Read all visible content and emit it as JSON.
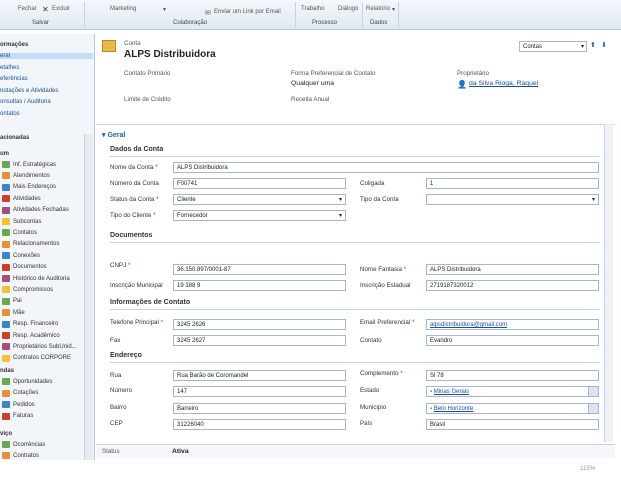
{
  "ribbon": {
    "fechar": "Fechar",
    "excluir": "Excluir",
    "marketing": "Marketing",
    "enviar": "Enviar um Link por Email",
    "trabalho": "Trabalho",
    "dialogo": "Diálogo",
    "relatorio": "Relatório",
    "g_salvar": "Salvar",
    "g_colab": "Colaboração",
    "g_processo": "Processo",
    "g_dados": "Dados"
  },
  "nav": {
    "sec_info": "ormações",
    "info": [
      "eral",
      "etalhes",
      "eferências",
      "notações e Atividades",
      "onsultas / Auditoria",
      "ontatos"
    ],
    "sec_rel": "acionadas",
    "sec_common": "um",
    "common": [
      "Inf. Estratégicas",
      "Atendimentos",
      "Mais Endereços",
      "Atividades",
      "Atividades Fechadas",
      "Subcontas",
      "Contatos",
      "Relacionamentos",
      "Conexões",
      "Documentos",
      "Histórico de Auditoria",
      "Compromissos",
      "Pai",
      "Mãe",
      "Resp. Financeiro",
      "Resp. Acadêmico",
      "Proprietários SubUnid...",
      "Contratos CORPORE"
    ],
    "sec_vendas": "ndas",
    "vendas": [
      "Oportunidades",
      "Cotações",
      "Pedidos",
      "Faturas"
    ],
    "sec_servico": "viço",
    "servico": [
      "Ocorrências",
      "Contratos"
    ]
  },
  "header": {
    "entity": "Conta",
    "name": "ALPS Distribuidora",
    "form_selector": "Contas",
    "contato_primario_label": "Contato Primário",
    "forma_label": "Forma Preferencial de Contato",
    "forma_value": "Qualquer uma",
    "proprietario_label": "Proprietário",
    "proprietario_value": "da Silva Rioga, Raquel",
    "limite_label": "Limite de Crédito",
    "receita_label": "Receita Anual"
  },
  "form": {
    "tab": "Geral",
    "s_dados": "Dados da Conta",
    "nome_label": "Nome da Conta",
    "nome": "ALPS Distribuidora",
    "numero_label": "Número da Conta",
    "numero": "F00741",
    "coligada_label": "Coligada",
    "coligada": "1",
    "status_label": "Status da Conta",
    "status": "Cliente",
    "tipoconta_label": "Tipo da Conta",
    "tipoconta": "",
    "tipocliente_label": "Tipo do Cliente",
    "tipocliente": "Fornecedor",
    "s_docs": "Documentos",
    "cnpj_label": "CNPJ",
    "cnpj": "36.150.897/0001-87",
    "fantasia_label": "Nome Fantasia",
    "fantasia": "ALPS Distribuidora",
    "im_label": "Inscrição Municipal",
    "im": "19 188 9",
    "ie_label": "Inscrição Estadual",
    "ie": "2719187320012",
    "s_contato": "Informações de Contato",
    "tel_label": "Telefone Principal",
    "tel": "3245 2626",
    "email_label": "Email Preferencial",
    "email": "alpsdistribuidora@gmail.com",
    "fax_label": "Fax",
    "fax": "3245 2627",
    "contato_label": "Contato",
    "contato": "Evandro",
    "s_end": "Endereço",
    "rua_label": "Rua",
    "rua": "Rua Barão de Coromandel",
    "compl_label": "Complemento",
    "compl": "Sl 78",
    "num_label": "Número",
    "num": "147",
    "estado_label": "Estado",
    "estado": "Minas Gerais",
    "bairro_label": "Bairro",
    "bairro": "Barreiro",
    "mun_label": "Municipio",
    "mun": "Belo Horizonte",
    "cep_label": "CEP",
    "cep": "31226040",
    "pais_label": "País",
    "pais": "Brasil"
  },
  "status": {
    "label": "Status",
    "value": "Ativa"
  },
  "zoom": "115%"
}
